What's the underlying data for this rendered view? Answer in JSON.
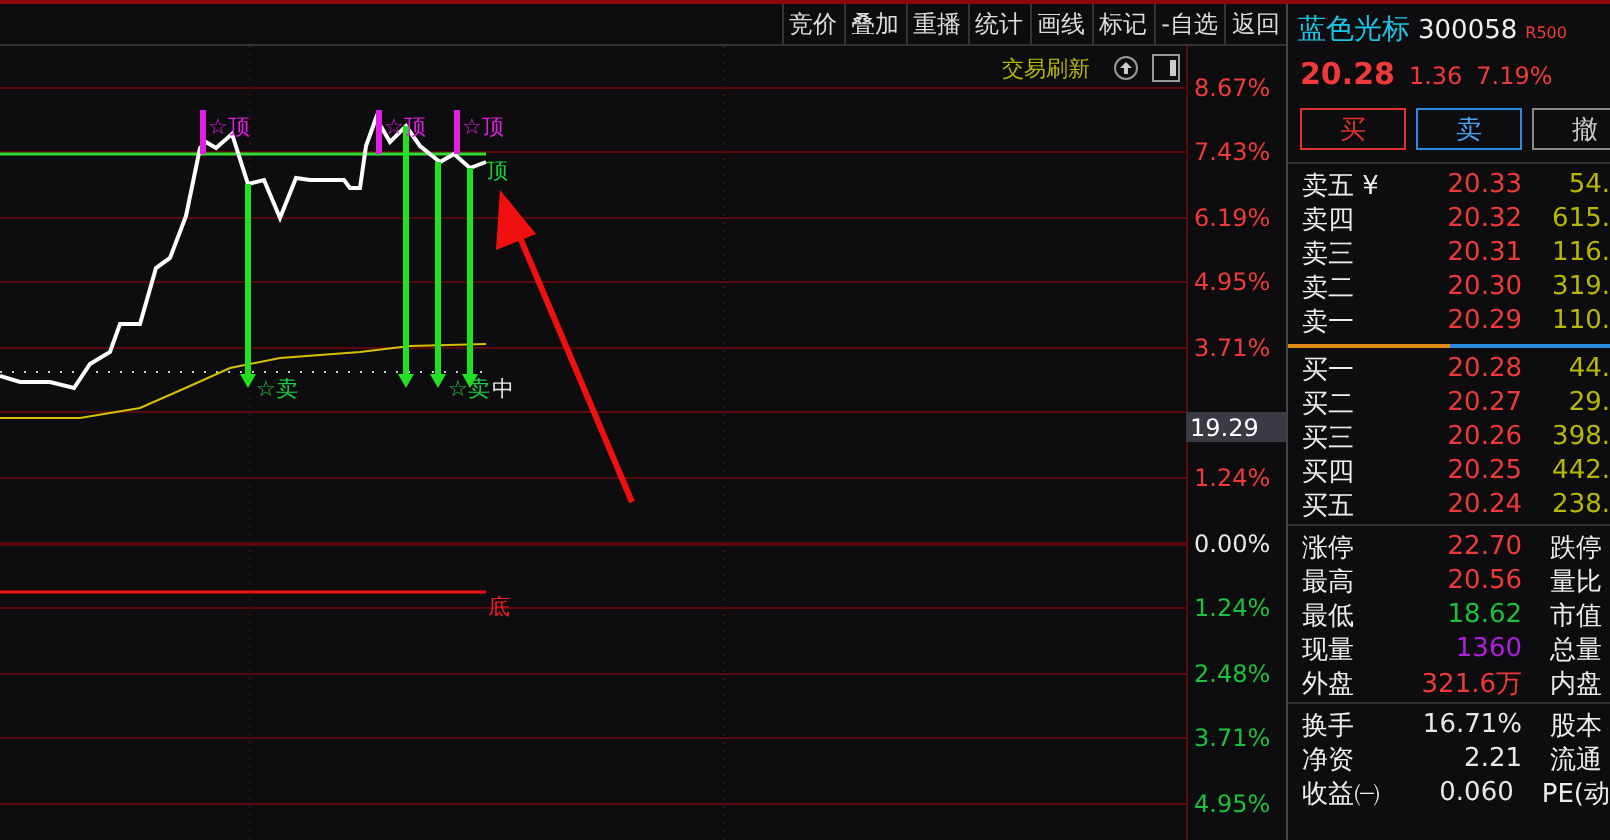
{
  "toolbar": {
    "buttons": [
      "竞价",
      "叠加",
      "重播",
      "统计",
      "画线",
      "标记",
      "-自选",
      "返回"
    ]
  },
  "chart": {
    "refresh_label": "交易刷新",
    "price_tag": "19.29",
    "axis_labels": [
      {
        "text": "8.67%",
        "color": "#f03a3a"
      },
      {
        "text": "7.43%",
        "color": "#f03a3a"
      },
      {
        "text": "6.19%",
        "color": "#f03a3a"
      },
      {
        "text": "4.95%",
        "color": "#f03a3a"
      },
      {
        "text": "3.71%",
        "color": "#f03a3a"
      },
      {
        "text": "1.24%",
        "color": "#f03a3a"
      },
      {
        "text": "0.00%",
        "color": "#e8e8e8"
      },
      {
        "text": "1.24%",
        "color": "#19c23a"
      },
      {
        "text": "2.48%",
        "color": "#19c23a"
      },
      {
        "text": "3.71%",
        "color": "#19c23a"
      },
      {
        "text": "4.95%",
        "color": "#19c23a"
      }
    ],
    "annotations": [
      {
        "kind": "top",
        "text": "☆顶"
      },
      {
        "kind": "top",
        "text": "☆顶"
      },
      {
        "kind": "top",
        "text": "☆顶"
      },
      {
        "kind": "top_end",
        "text": "顶"
      },
      {
        "kind": "sell",
        "text": "☆卖"
      },
      {
        "kind": "sell",
        "text": "☆卖"
      },
      {
        "kind": "mid",
        "text": "中"
      },
      {
        "kind": "bottom",
        "text": "底"
      }
    ]
  },
  "stock": {
    "name": "蓝色光标",
    "code": "300058",
    "badge": "R500"
  },
  "quote": {
    "price": "20.28",
    "change": "1.36",
    "pct": "7.19%"
  },
  "trade_buttons": [
    {
      "label": "买",
      "kind": "buy"
    },
    {
      "label": "卖",
      "kind": "sell"
    },
    {
      "label": "撤",
      "kind": "cancel"
    }
  ],
  "asks": [
    {
      "label": "卖五 ¥",
      "price": "20.33",
      "volume": "54."
    },
    {
      "label": "卖四",
      "price": "20.32",
      "volume": "615."
    },
    {
      "label": "卖三",
      "price": "20.31",
      "volume": "116."
    },
    {
      "label": "卖二",
      "price": "20.30",
      "volume": "319."
    },
    {
      "label": "卖一",
      "price": "20.29",
      "volume": "110."
    }
  ],
  "bids": [
    {
      "label": "买一",
      "price": "20.28",
      "volume": "44."
    },
    {
      "label": "买二",
      "price": "20.27",
      "volume": "29."
    },
    {
      "label": "买三",
      "price": "20.26",
      "volume": "398."
    },
    {
      "label": "买四",
      "price": "20.25",
      "volume": "442."
    },
    {
      "label": "买五",
      "price": "20.24",
      "volume": "238."
    }
  ],
  "stats": [
    {
      "label": "涨停",
      "value": "22.70",
      "color": "#f03a3a",
      "label2": "跌停"
    },
    {
      "label": "最高",
      "value": "20.56",
      "color": "#f03a3a",
      "label2": "量比"
    },
    {
      "label": "最低",
      "value": "18.62",
      "color": "#19c23a",
      "label2": "市值"
    },
    {
      "label": "现量",
      "value": "1360",
      "color": "#b01ee0",
      "label2": "总量"
    },
    {
      "label": "外盘",
      "value": "321.6万",
      "color": "#f03a3a",
      "label2": "内盘"
    }
  ],
  "stats2": [
    {
      "label": "换手",
      "value": "16.71%",
      "color": "#e8e8e8",
      "label2": "股本"
    },
    {
      "label": "净资",
      "value": "2.21",
      "color": "#e8e8e8",
      "label2": "流通"
    },
    {
      "label": "收益㈠",
      "value": "0.060",
      "color": "#e8e8e8",
      "label2": "PE(动"
    }
  ]
}
